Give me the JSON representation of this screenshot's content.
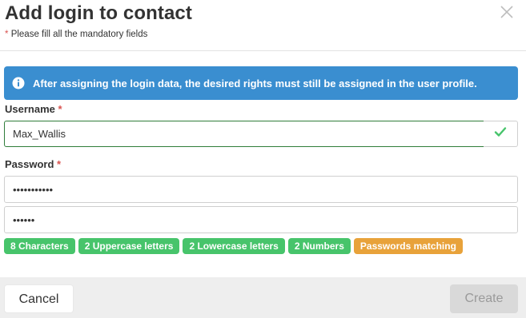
{
  "dialog": {
    "title": "Add login to contact",
    "mandatory_note": "Please fill all the mandatory fields",
    "required_mark": "*"
  },
  "info": {
    "icon": "info-circle-icon",
    "text": "After assigning the login data, the desired rights must still be assigned in the user profile."
  },
  "username": {
    "label": "Username",
    "value": "Max_Wallis",
    "status_icon": "checkmark-icon"
  },
  "password": {
    "label": "Password",
    "value": "•••••••••••",
    "confirm_value": "••••••"
  },
  "requirements": [
    {
      "label": "8  Characters",
      "status": "met"
    },
    {
      "label": "2  Uppercase letters",
      "status": "met"
    },
    {
      "label": "2  Lowercase letters",
      "status": "met"
    },
    {
      "label": "2  Numbers",
      "status": "met"
    },
    {
      "label": "Passwords matching",
      "status": "unmet"
    }
  ],
  "footer": {
    "cancel_label": "Cancel",
    "create_label": "Create"
  },
  "colors": {
    "info_bg": "#3a8ed0",
    "met": "#47c46b",
    "unmet": "#e8a23a",
    "required": "#d9534f",
    "valid_check": "#47c46b"
  }
}
